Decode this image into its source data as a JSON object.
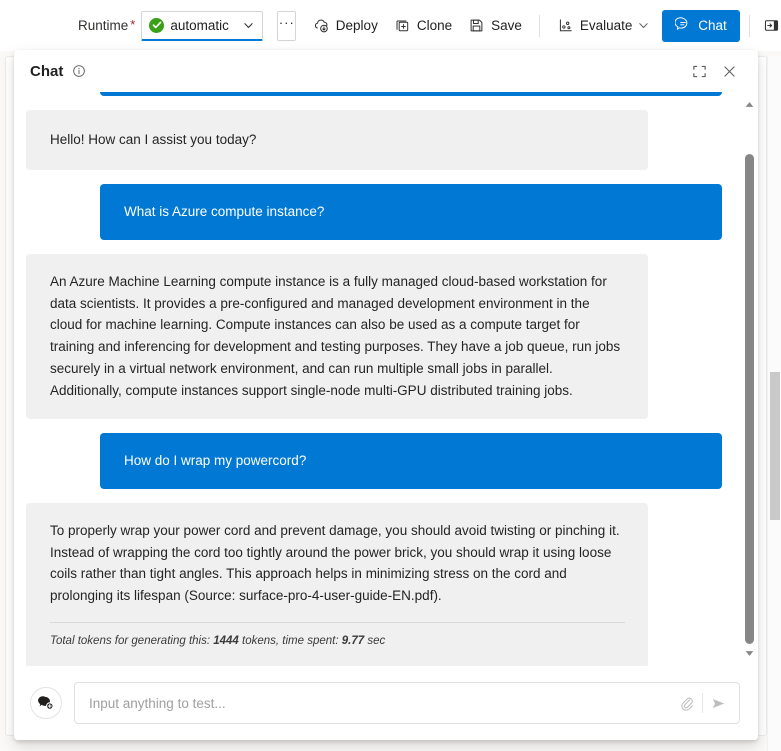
{
  "toolbar": {
    "runtime_label": "Runtime",
    "required_marker": "*",
    "runtime_value": "automatic",
    "runtime_status_icon": "check-circle-icon",
    "runtime_chevron_icon": "chevron-down-icon",
    "more_label": "···",
    "deploy_label": "Deploy",
    "deploy_icon": "cloud-deploy-icon",
    "clone_label": "Clone",
    "clone_icon": "clone-icon",
    "save_label": "Save",
    "save_icon": "save-disk-icon",
    "evaluate_label": "Evaluate",
    "evaluate_icon": "evaluate-chart-icon",
    "evaluate_chevron_icon": "chevron-down-icon",
    "chat_label": "Chat",
    "chat_icon": "chat-bubble-icon",
    "panel_toggle_icon": "open-panel-right-icon"
  },
  "chat_panel": {
    "title": "Chat",
    "info_icon": "info-circle-icon",
    "expand_icon": "collapse-corners-icon",
    "close_icon": "close-x-icon",
    "scroll_up_icon": "scroll-arrow-up-icon",
    "scroll_down_icon": "scroll-arrow-down-icon"
  },
  "messages": [
    {
      "role": "bot",
      "text": "Hello! How can I assist you today?"
    },
    {
      "role": "user",
      "text": "What is Azure compute instance?"
    },
    {
      "role": "bot",
      "text": "An Azure Machine Learning compute instance is a fully managed cloud-based workstation for data scientists. It provides a pre-configured and managed development environment in the cloud for machine learning. Compute instances can also be used as a compute target for training and inferencing for development and testing purposes. They have a job queue, run jobs securely in a virtual network environment, and can run multiple small jobs in parallel. Additionally, compute instances support single-node multi-GPU distributed training jobs."
    },
    {
      "role": "user",
      "text": "How do I wrap my powercord?"
    },
    {
      "role": "bot",
      "text": "To properly wrap your power cord and prevent damage, you should avoid twisting or pinching it. Instead of wrapping the cord too tightly around the power brick, you should wrap it using loose coils rather than tight angles. This approach helps in minimizing stress on the cord and prolonging its lifespan (Source: surface-pro-4-user-guide-EN.pdf)."
    }
  ],
  "token_stats": {
    "prefix": "Total tokens for generating this: ",
    "tokens": "1444",
    "middle": " tokens, time spent: ",
    "time": "9.77",
    "suffix": " sec"
  },
  "input_bar": {
    "new_chat_icon": "new-chat-bubble-plus-icon",
    "placeholder": "Input anything to test...",
    "value": "",
    "attach_icon": "paperclip-icon",
    "send_icon": "send-paper-plane-icon"
  },
  "colors": {
    "accent_blue": "#0078d4",
    "user_bubble": "#0078d4",
    "bot_bubble": "#f0f0f0",
    "success_green": "#3aa017",
    "required_red": "#a4262c"
  }
}
